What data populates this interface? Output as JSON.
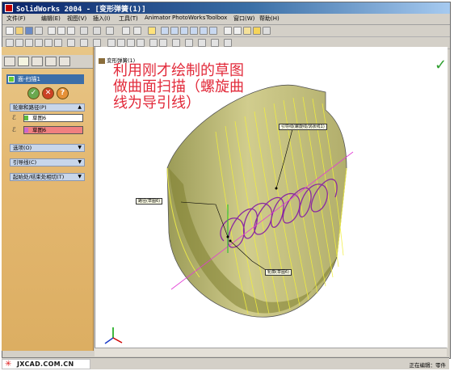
{
  "window": {
    "title": "SolidWorks 2004 - [变形弹簧(1)]"
  },
  "menu": {
    "items": [
      "文件(F)",
      "编辑(E)",
      "视图(V)",
      "插入(I)",
      "工具(T)",
      "Animator",
      "PhotoWorks",
      "Toolbox",
      "窗口(W)",
      "帮助(H)"
    ]
  },
  "feature_tree": {
    "part_name": "变形弹簧(1)"
  },
  "property_manager": {
    "header": "面-扫描1",
    "ok_icon": "check-icon",
    "cancel_icon": "close-icon",
    "help_label": "?",
    "profile_path_group": "轮廓和路径(P)",
    "profile_sketch": "草图6",
    "path_sketch": "草图6",
    "options_group": "选项(O)",
    "guide_curves_group": "引导线(C)",
    "start_end_group": "起始处/结束处相切(T)",
    "colors": {
      "profile": "#5fbd3f",
      "path": "#cc66cc",
      "path_field": "#f08080"
    }
  },
  "canvas": {
    "annotation": "利用刚才绘制的草图\n做曲面扫描（螺旋曲\n线为导引线）",
    "callouts": {
      "top_right": "引导线(螺旋线/涡状线1)",
      "left": "路径(草图6)",
      "bottom": "轮廓(草图6)"
    },
    "confirm_icon": "check-icon"
  },
  "status": {
    "text": "正在编辑：零件"
  },
  "watermark": {
    "text": "JXCAD.COM.CN"
  }
}
